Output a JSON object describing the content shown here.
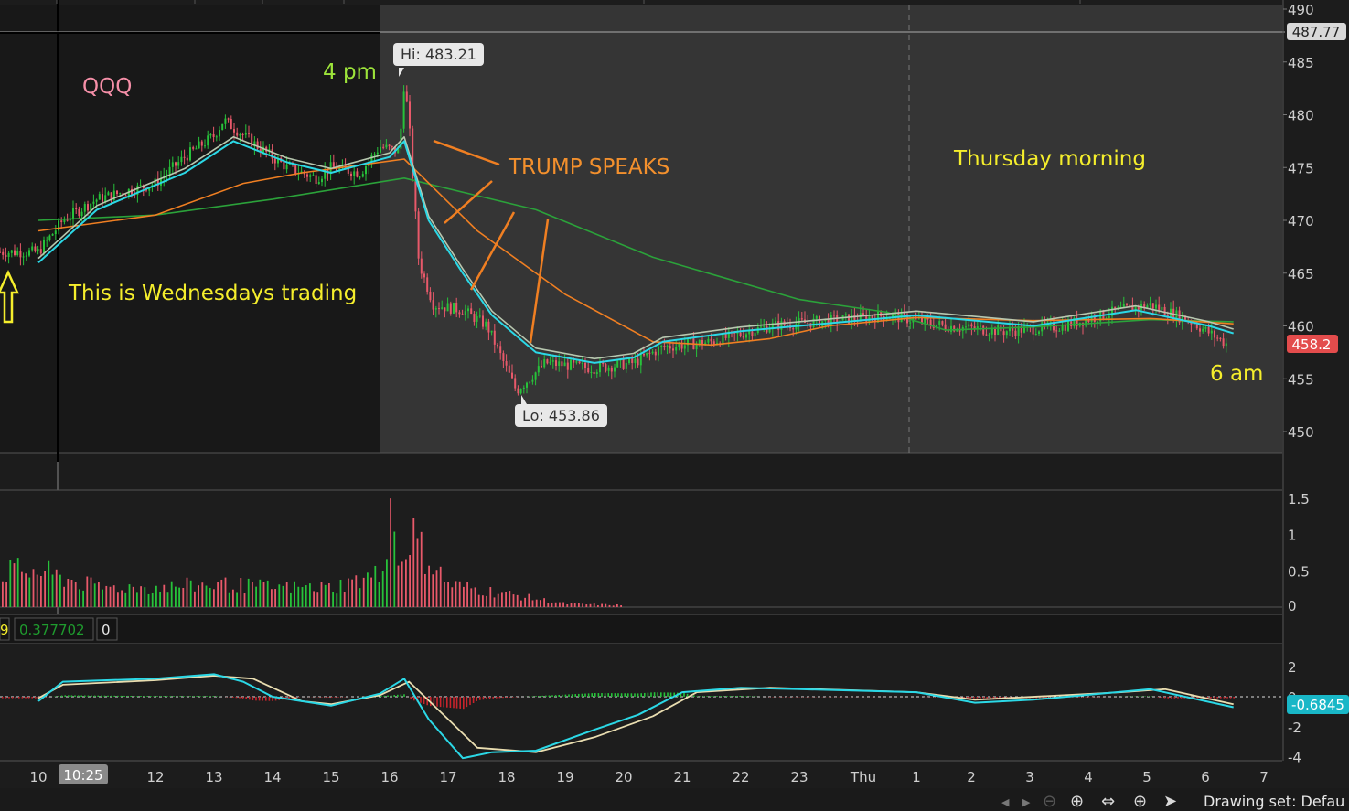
{
  "colors": {
    "background": "#1c1c1c",
    "wed_panel": "#181818",
    "thu_panel": "#353535",
    "up": "#27c23a",
    "down": "#e8596a",
    "ema_fast": "#2bd8e6",
    "ema_mid": "#b8c8b0",
    "ema_slow": "#f07f22",
    "ema_long": "#2ba23a",
    "macd_line": "#2bd8e6",
    "signal_line": "#e9ddb0",
    "last_price_badge": "#e34c4c",
    "macd_badge": "#19b7c7"
  },
  "annotations": {
    "ticker": "QQQ",
    "four_pm": "4 pm",
    "trump": "TRUMP SPEAKS",
    "thursday": "Thursday morning",
    "wednesday": "This is Wednesdays trading",
    "six_am": "6  am",
    "hi_label": "Hi: 483.21",
    "lo_label": "Lo: 453.86"
  },
  "price_axis": {
    "ticks": [
      "490",
      "485",
      "480",
      "475",
      "470",
      "465",
      "460",
      "455",
      "450"
    ],
    "crosshair_value": "487.77",
    "last_price": "458.2"
  },
  "volume_axis": {
    "ticks": [
      "1.5",
      "1",
      "0.5",
      "0"
    ]
  },
  "macd_header": {
    "fragment": "9",
    "value": "0.377702",
    "zero": "0"
  },
  "macd_axis": {
    "ticks": [
      "2",
      "0",
      "-2",
      "-4"
    ],
    "last_value": "-0.6845"
  },
  "time_axis": {
    "labels": [
      "10",
      "12",
      "13",
      "14",
      "15",
      "16",
      "17",
      "18",
      "19",
      "20",
      "21",
      "22",
      "23",
      "Thu",
      "1",
      "2",
      "3",
      "4",
      "5",
      "6",
      "7"
    ],
    "crosshair_time": "10:25"
  },
  "toolbar": {
    "drawing_set": "Drawing set: Defau",
    "icons": [
      "scroll-left-icon",
      "scroll-right-icon",
      "zoom-out-icon",
      "zoom-in-icon",
      "pan-icon",
      "crosshair-icon",
      "pointer-icon"
    ]
  },
  "chart_data": {
    "type": "candlestick",
    "symbol": "QQQ",
    "price_ylim": [
      448,
      491
    ],
    "volume_ylim": [
      0,
      1.6
    ],
    "macd_ylim": [
      -4.2,
      3
    ],
    "price_path": [
      {
        "t": "10:00",
        "p": 467
      },
      {
        "t": "10:25",
        "p": 470
      },
      {
        "t": "11:00",
        "p": 472
      },
      {
        "t": "12:00",
        "p": 473.5
      },
      {
        "t": "12:30",
        "p": 476
      },
      {
        "t": "13:00",
        "p": 478
      },
      {
        "t": "13:10",
        "p": 479.5
      },
      {
        "t": "13:45",
        "p": 477
      },
      {
        "t": "14:15",
        "p": 475
      },
      {
        "t": "14:45",
        "p": 474
      },
      {
        "t": "15:00",
        "p": 475
      },
      {
        "t": "15:30",
        "p": 474.5
      },
      {
        "t": "15:50",
        "p": 477
      },
      {
        "t": "16:10",
        "p": 476.5
      },
      {
        "t": "16:15",
        "p": 483.21
      },
      {
        "t": "16:20",
        "p": 479
      },
      {
        "t": "16:30",
        "p": 466
      },
      {
        "t": "16:45",
        "p": 462
      },
      {
        "t": "17:15",
        "p": 461.5
      },
      {
        "t": "17:40",
        "p": 460
      },
      {
        "t": "18:10",
        "p": 453.86
      },
      {
        "t": "18:40",
        "p": 456.5
      },
      {
        "t": "19:30",
        "p": 456
      },
      {
        "t": "20:10",
        "p": 456.5
      },
      {
        "t": "20:40",
        "p": 458
      },
      {
        "t": "21:30",
        "p": 458.5
      },
      {
        "t": "22:30",
        "p": 460
      },
      {
        "t": "23:30",
        "p": 460.5
      },
      {
        "t": "00:30",
        "p": 461
      },
      {
        "t": "01:30",
        "p": 460
      },
      {
        "t": "02:30",
        "p": 459.5
      },
      {
        "t": "03:30",
        "p": 460
      },
      {
        "t": "04:30",
        "p": 461.5
      },
      {
        "t": "05:00",
        "p": 462
      },
      {
        "t": "05:40",
        "p": 460.5
      },
      {
        "t": "06:20",
        "p": 458.2
      }
    ],
    "ema_fast": [
      {
        "t": "10:00",
        "p": 466
      },
      {
        "t": "11:00",
        "p": 471
      },
      {
        "t": "12:30",
        "p": 474.5
      },
      {
        "t": "13:20",
        "p": 477.5
      },
      {
        "t": "14:15",
        "p": 475.5
      },
      {
        "t": "15:00",
        "p": 474.5
      },
      {
        "t": "16:00",
        "p": 476
      },
      {
        "t": "16:15",
        "p": 477.5
      },
      {
        "t": "16:40",
        "p": 470
      },
      {
        "t": "17:15",
        "p": 465
      },
      {
        "t": "17:45",
        "p": 461
      },
      {
        "t": "18:30",
        "p": 457.5
      },
      {
        "t": "19:30",
        "p": 456.5
      },
      {
        "t": "20:10",
        "p": 457
      },
      {
        "t": "20:40",
        "p": 458.5
      },
      {
        "t": "22:00",
        "p": 459.5
      },
      {
        "t": "00:00",
        "p": 460.5
      },
      {
        "t": "01:00",
        "p": 461
      },
      {
        "t": "03:00",
        "p": 460
      },
      {
        "t": "04:45",
        "p": 461.5
      },
      {
        "t": "06:00",
        "p": 460
      },
      {
        "t": "06:25",
        "p": 459.3
      }
    ],
    "ema_slow": [
      {
        "t": "10:00",
        "p": 469
      },
      {
        "t": "12:00",
        "p": 470.5
      },
      {
        "t": "13:30",
        "p": 473.5
      },
      {
        "t": "14:30",
        "p": 474.5
      },
      {
        "t": "16:15",
        "p": 475.8
      },
      {
        "t": "17:30",
        "p": 469
      },
      {
        "t": "19:00",
        "p": 463
      },
      {
        "t": "20:30",
        "p": 458.5
      },
      {
        "t": "21:30",
        "p": 458.2
      },
      {
        "t": "22:30",
        "p": 458.8
      },
      {
        "t": "23:30",
        "p": 460
      },
      {
        "t": "01:00",
        "p": 460.8
      },
      {
        "t": "03:00",
        "p": 460.5
      },
      {
        "t": "05:00",
        "p": 460.7
      },
      {
        "t": "06:25",
        "p": 460.2
      }
    ],
    "ema_long": [
      {
        "t": "10:00",
        "p": 470
      },
      {
        "t": "12:00",
        "p": 470.5
      },
      {
        "t": "14:00",
        "p": 472
      },
      {
        "t": "16:15",
        "p": 474
      },
      {
        "t": "18:30",
        "p": 471
      },
      {
        "t": "20:30",
        "p": 466.5
      },
      {
        "t": "23:00",
        "p": 462.5
      },
      {
        "t": "00:30",
        "p": 461.3
      },
      {
        "t": "01:30",
        "p": 459.6
      },
      {
        "t": "03:00",
        "p": 459.9
      },
      {
        "t": "05:00",
        "p": 460.6
      },
      {
        "t": "06:25",
        "p": 460.4
      }
    ],
    "volume_profile": [
      {
        "t": "10:00",
        "v": 0.55
      },
      {
        "t": "11:00",
        "v": 0.3
      },
      {
        "t": "12:00",
        "v": 0.3
      },
      {
        "t": "13:00",
        "v": 0.35
      },
      {
        "t": "14:00",
        "v": 0.3
      },
      {
        "t": "15:00",
        "v": 0.3
      },
      {
        "t": "15:50",
        "v": 0.5
      },
      {
        "t": "16:00",
        "v": 1.55
      },
      {
        "t": "16:10",
        "v": 0.6
      },
      {
        "t": "16:20",
        "v": 1.2
      },
      {
        "t": "16:30",
        "v": 0.9
      },
      {
        "t": "17:00",
        "v": 0.35
      },
      {
        "t": "18:00",
        "v": 0.2
      },
      {
        "t": "19:00",
        "v": 0.05
      },
      {
        "t": "20:00",
        "v": 0.03
      }
    ],
    "macd_line": [
      {
        "t": "10:00",
        "v": -0.3
      },
      {
        "t": "10:25",
        "v": 1.0
      },
      {
        "t": "12:00",
        "v": 1.2
      },
      {
        "t": "13:00",
        "v": 1.5
      },
      {
        "t": "13:30",
        "v": 1.0
      },
      {
        "t": "14:00",
        "v": 0
      },
      {
        "t": "15:00",
        "v": -0.6
      },
      {
        "t": "15:50",
        "v": 0.2
      },
      {
        "t": "16:15",
        "v": 1.2
      },
      {
        "t": "16:40",
        "v": -1.5
      },
      {
        "t": "17:15",
        "v": -4.1
      },
      {
        "t": "17:45",
        "v": -3.7
      },
      {
        "t": "18:30",
        "v": -3.6
      },
      {
        "t": "19:30",
        "v": -2.2
      },
      {
        "t": "20:15",
        "v": -1.2
      },
      {
        "t": "21:00",
        "v": 0.3
      },
      {
        "t": "22:00",
        "v": 0.6
      },
      {
        "t": "23:00",
        "v": 0.5
      },
      {
        "t": "01:00",
        "v": 0.3
      },
      {
        "t": "02:00",
        "v": -0.4
      },
      {
        "t": "03:00",
        "v": -0.2
      },
      {
        "t": "05:00",
        "v": 0.5
      },
      {
        "t": "06:25",
        "v": -0.7
      }
    ],
    "signal_line": [
      {
        "t": "10:00",
        "v": -0.1
      },
      {
        "t": "10:25",
        "v": 0.8
      },
      {
        "t": "12:00",
        "v": 1.1
      },
      {
        "t": "13:00",
        "v": 1.4
      },
      {
        "t": "13:40",
        "v": 1.2
      },
      {
        "t": "14:30",
        "v": -0.3
      },
      {
        "t": "15:00",
        "v": -0.5
      },
      {
        "t": "15:50",
        "v": 0.1
      },
      {
        "t": "16:20",
        "v": 1.0
      },
      {
        "t": "17:00",
        "v": -1.5
      },
      {
        "t": "17:30",
        "v": -3.4
      },
      {
        "t": "18:30",
        "v": -3.7
      },
      {
        "t": "19:30",
        "v": -2.7
      },
      {
        "t": "20:30",
        "v": -1.3
      },
      {
        "t": "21:15",
        "v": 0.3
      },
      {
        "t": "22:30",
        "v": 0.6
      },
      {
        "t": "01:00",
        "v": 0.3
      },
      {
        "t": "02:00",
        "v": -0.2
      },
      {
        "t": "04:30",
        "v": 0.3
      },
      {
        "t": "05:15",
        "v": 0.5
      },
      {
        "t": "06:25",
        "v": -0.5
      }
    ]
  }
}
